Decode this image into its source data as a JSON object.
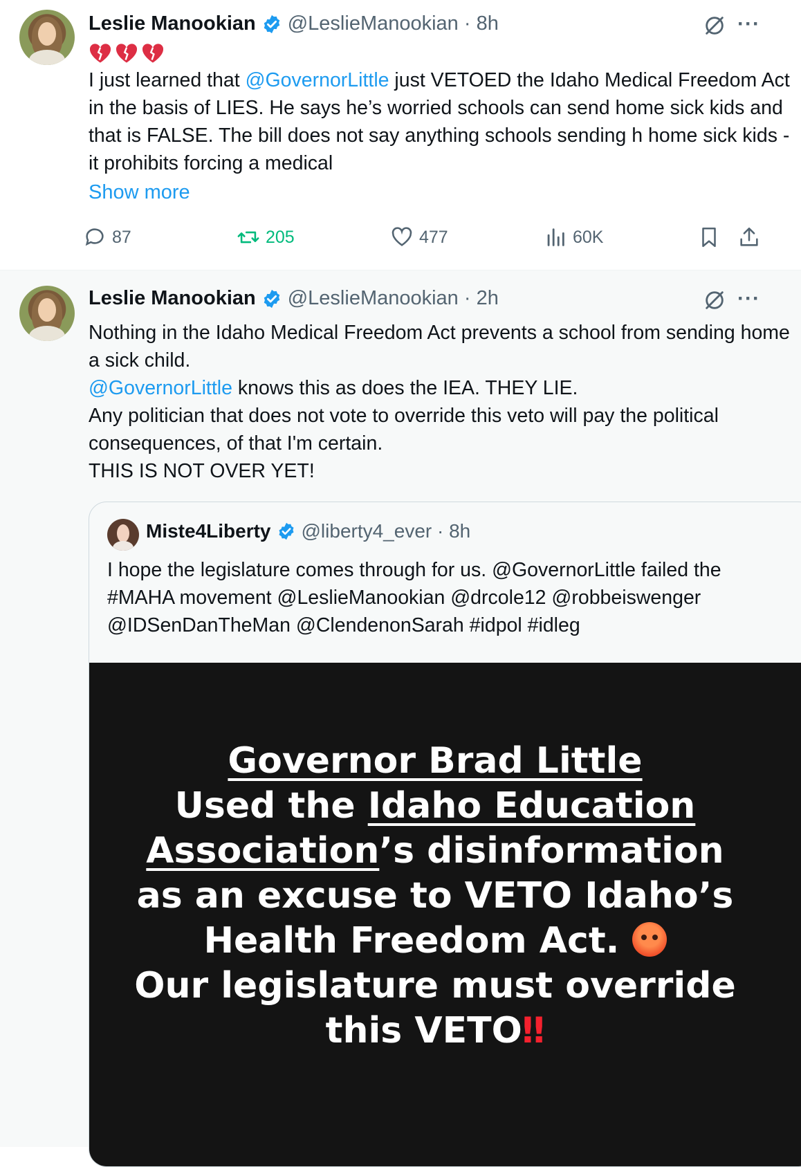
{
  "tweet1": {
    "name": "Leslie Manookian",
    "handle_time": "@LeslieManookian · 8h",
    "emoji": "💔💔💔",
    "text_before": "I just learned that ",
    "mention": "@GovernorLittle",
    "text_after": " just VETOED the Idaho Medical Freedom Act in the basis of LIES. He says he’s worried schools can send home sick kids and that is FALSE. The bill does not say anything schools sending h home sick kids - it prohibits forcing a medical",
    "show_more": "Show more",
    "actions": {
      "replies": "87",
      "reposts": "205",
      "likes": "477",
      "views": "60K"
    }
  },
  "tweet2": {
    "name": "Leslie Manookian",
    "handle_time": "@LeslieManookian · 2h",
    "line1": "Nothing in the Idaho Medical Freedom Act prevents a school from sending home a sick child.",
    "mention": "@GovernorLittle",
    "line2_after": " knows this as does the IEA. THEY LIE.",
    "line3": "Any politician that does not vote to override this veto will pay the political consequences, of that I'm certain.",
    "line4": "THIS IS NOT OVER YET!"
  },
  "quote": {
    "name": "Miste4Liberty",
    "handle_time": "@liberty4_ever · 8h",
    "text": "I hope the legislature comes through for us. @GovernorLittle failed the #MAHA movement @LeslieManookian @drcole12 @robbeiswenger @IDSenDanTheMan @ClendenonSarah #idpol #idleg",
    "image": {
      "l1": "Governor Brad Little",
      "l2a": "Used the ",
      "l2b": "Idaho Education",
      "l3a": "Association",
      "l3b": "’s disinformation",
      "l4": "as an excuse to VETO Idaho’s",
      "l5": "Health Freedom Act. ",
      "l6": "Our legislature must override",
      "l7": "this VETO",
      "bang": "‼"
    }
  },
  "icons": {
    "verified": "verified-badge-icon",
    "grok": "grok-icon",
    "more": "more-icon",
    "reply": "reply-icon",
    "repost": "repost-icon",
    "like": "like-icon",
    "views": "views-icon",
    "bookmark": "bookmark-icon",
    "share": "share-icon"
  },
  "colors": {
    "accent": "#1d9bf0",
    "repost": "#00ba7c",
    "muted": "#536471",
    "alert": "#f4212e"
  },
  "more_glyph": "···"
}
